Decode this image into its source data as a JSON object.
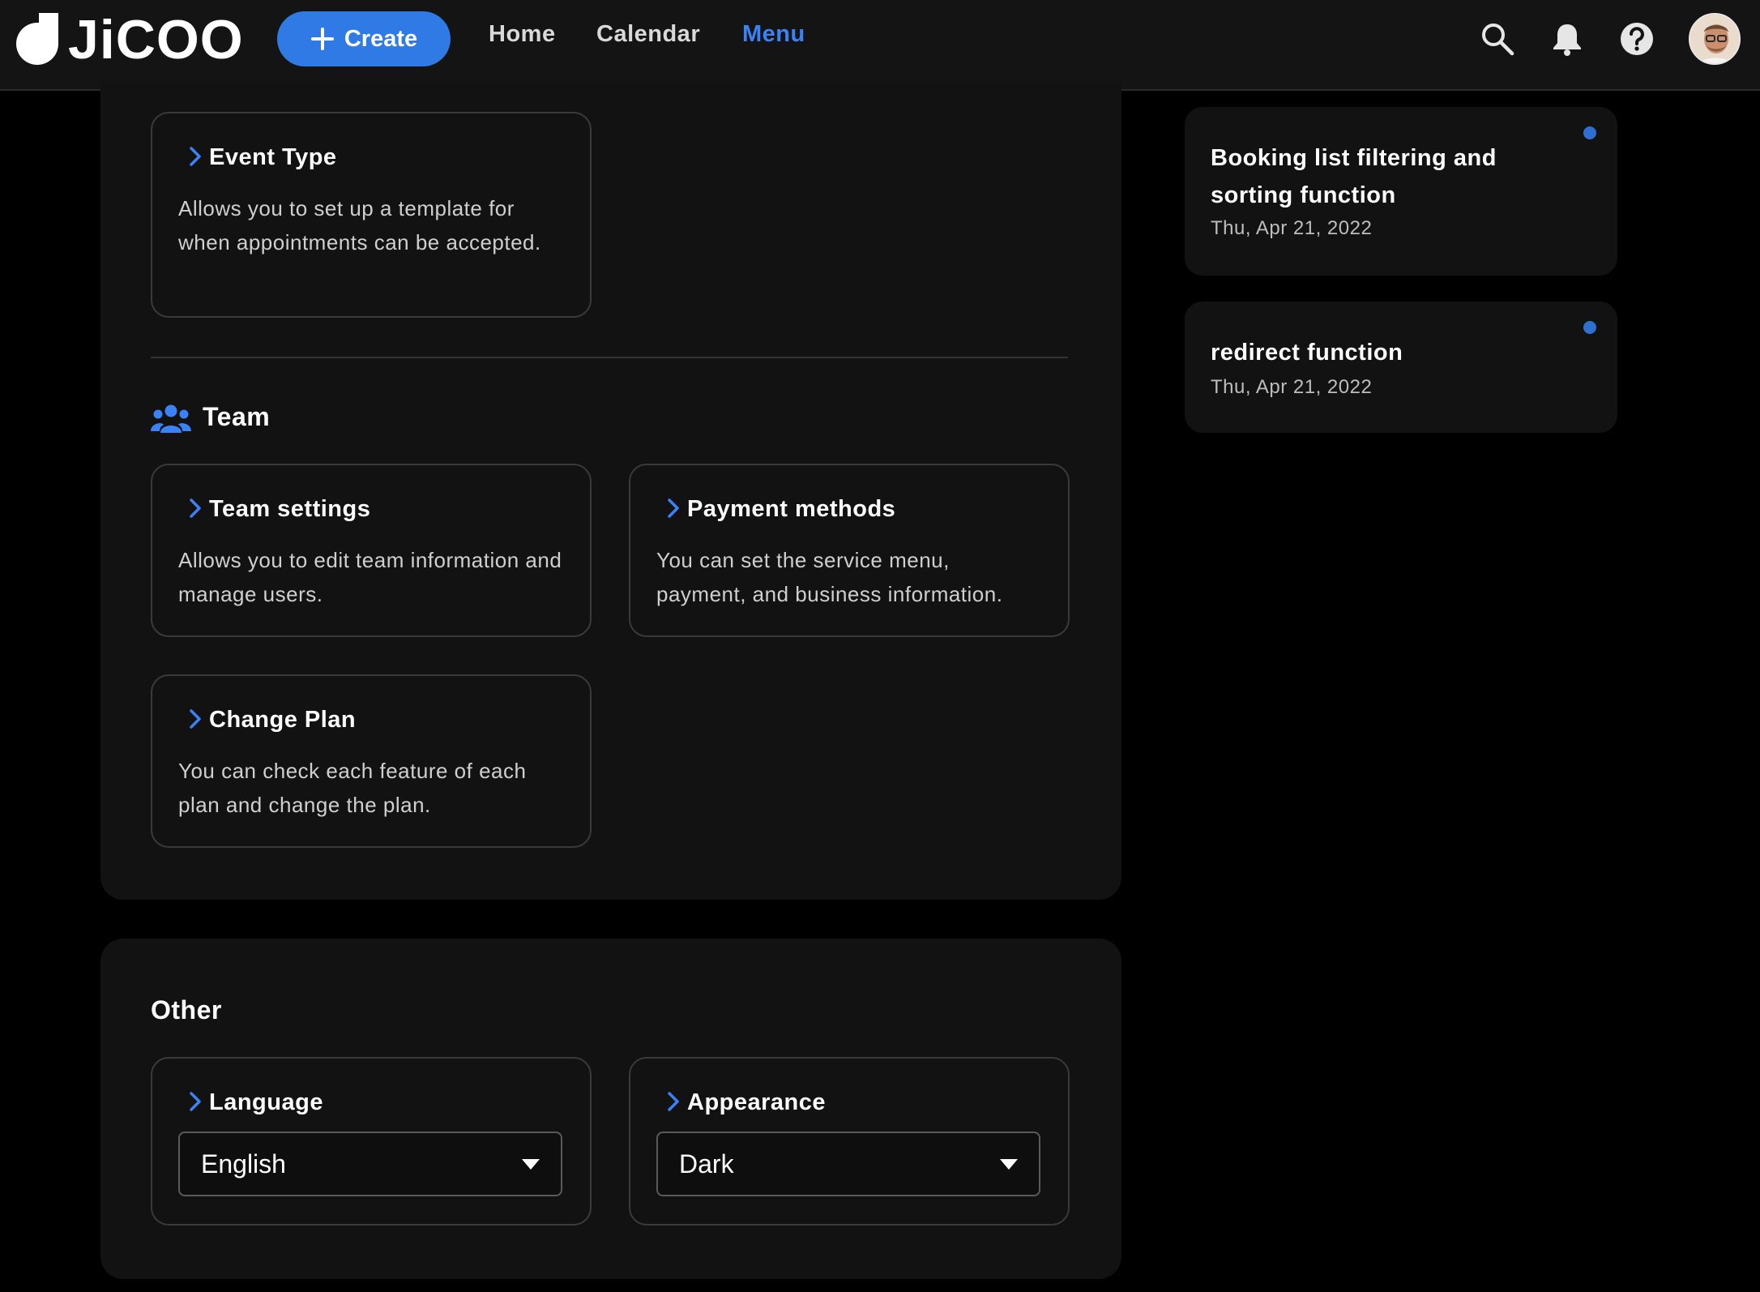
{
  "app": {
    "logo_text": "JiCOO"
  },
  "header": {
    "create_label": "Create",
    "nav": [
      {
        "label": "Home",
        "active": false
      },
      {
        "label": "Calendar",
        "active": false
      },
      {
        "label": "Menu",
        "active": true
      }
    ],
    "icons": [
      "search-icon",
      "bell-icon",
      "help-icon",
      "avatar"
    ]
  },
  "colors": {
    "accent": "#2f7ae5",
    "active_nav": "#3b82f6",
    "dot": "#2f6fd0",
    "panel": "#121212",
    "background": "#000000"
  },
  "main": {
    "event_type": {
      "title": "Event Type",
      "desc": "Allows you to set up a template for when appointments can be accepted."
    },
    "team": {
      "heading": "Team",
      "cards": [
        {
          "title": "Team settings",
          "desc": "Allows you to edit team information and manage users."
        },
        {
          "title": "Payment methods",
          "desc": "You can set the service menu, payment, and business information."
        },
        {
          "title": "Change Plan",
          "desc": "You can check each feature of each plan and change the plan."
        }
      ]
    },
    "other": {
      "heading": "Other",
      "language": {
        "title": "Language",
        "value": "English"
      },
      "appearance": {
        "title": "Appearance",
        "value": "Dark"
      }
    }
  },
  "notices": [
    {
      "title": "Booking list filtering and sorting function",
      "date": "Thu, Apr 21, 2022",
      "unread": true
    },
    {
      "title": "redirect function",
      "date": "Thu, Apr 21, 2022",
      "unread": true
    }
  ]
}
